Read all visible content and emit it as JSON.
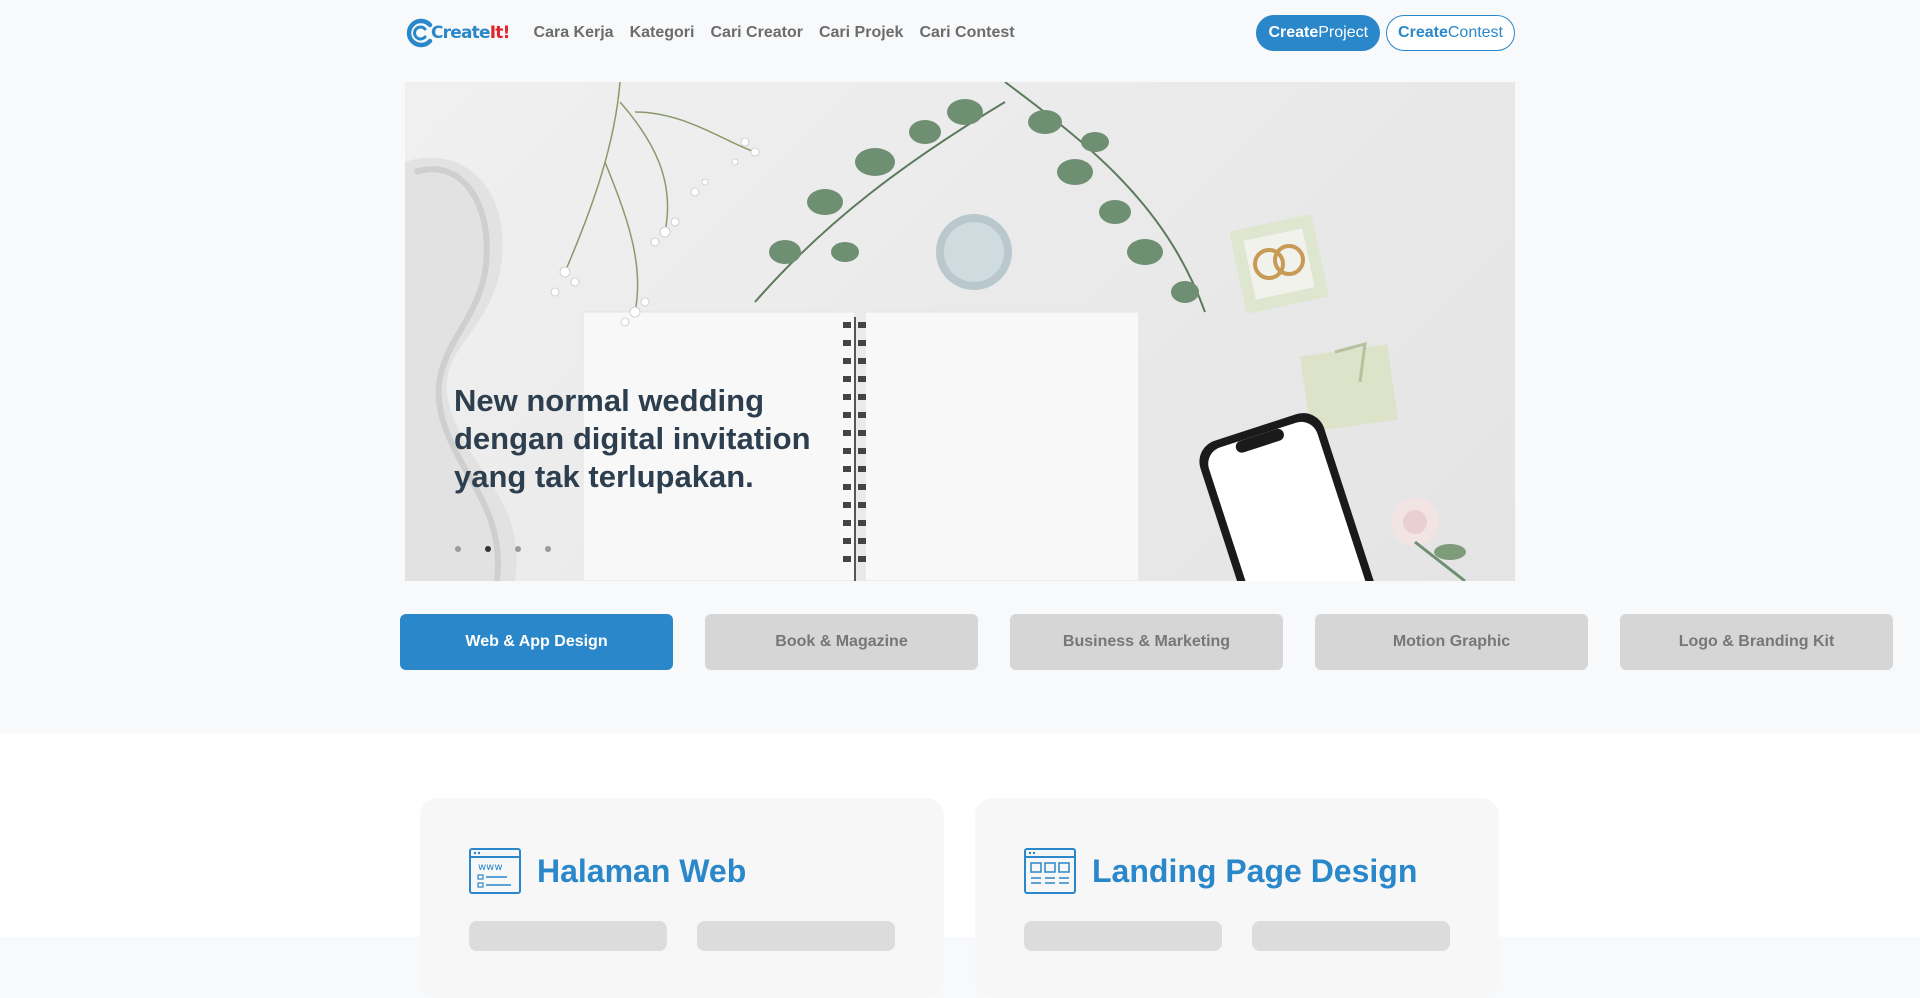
{
  "logo": {
    "part1": "Create",
    "part2": "It!"
  },
  "nav": {
    "links": [
      "Cara Kerja",
      "Kategori",
      "Cari Creator",
      "Cari Projek",
      "Cari Contest"
    ],
    "create_project": {
      "bold": "Create",
      "rest": "Project"
    },
    "create_contest": {
      "bold": "Create",
      "rest": "Contest"
    }
  },
  "hero": {
    "caption": "New normal wedding dengan digital invitation yang tak terlupakan.",
    "slides": 4,
    "active_slide": 2
  },
  "categories": [
    {
      "label": "Web & App Design",
      "active": true
    },
    {
      "label": "Book & Magazine",
      "active": false
    },
    {
      "label": "Business & Marketing",
      "active": false
    },
    {
      "label": "Motion Graphic",
      "active": false
    },
    {
      "label": "Logo & Branding Kit",
      "active": false
    }
  ],
  "cards": [
    {
      "title": "Halaman Web",
      "icon": "www-browser-icon"
    },
    {
      "title": "Landing Page Design",
      "icon": "layout-grid-icon"
    }
  ],
  "colors": {
    "brand": "#2a87c9",
    "accent": "#e3242b",
    "heading": "#2d3e4e"
  }
}
